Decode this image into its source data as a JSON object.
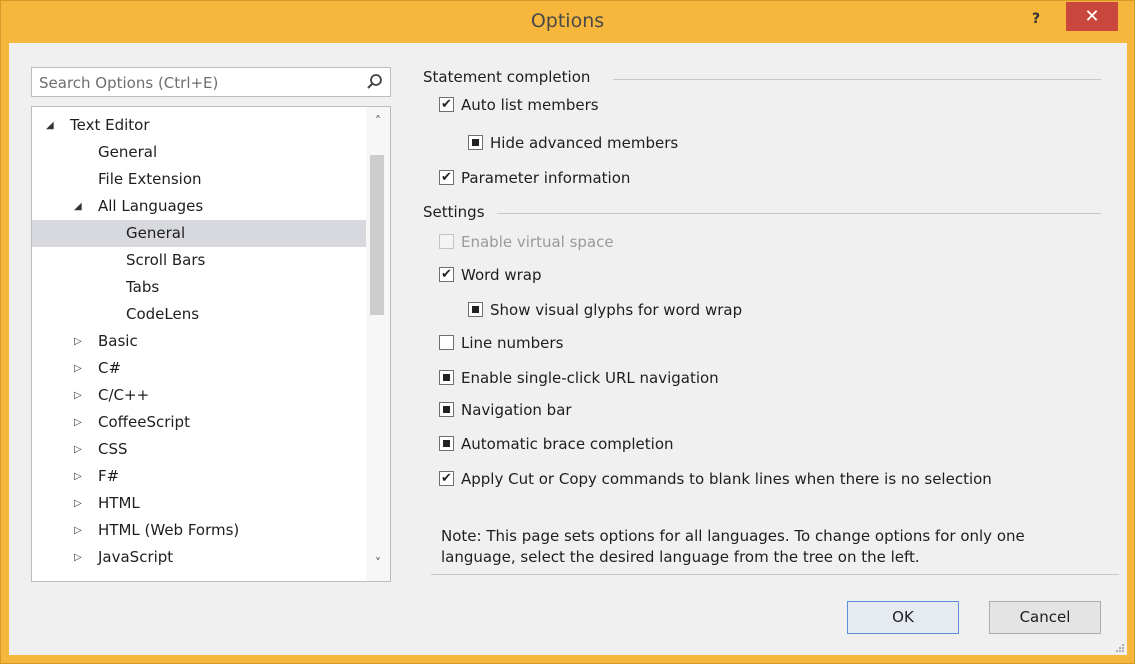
{
  "window": {
    "title": "Options",
    "help_glyph": "?",
    "close_glyph": "✕"
  },
  "search": {
    "placeholder": "Search Options (Ctrl+E)"
  },
  "tree": {
    "items": [
      {
        "label": "Text Editor",
        "arrow": "◢"
      },
      {
        "label": "General",
        "arrow": ""
      },
      {
        "label": "File Extension",
        "arrow": ""
      },
      {
        "label": "All Languages",
        "arrow": "◢"
      },
      {
        "label": "General",
        "arrow": ""
      },
      {
        "label": "Scroll Bars",
        "arrow": ""
      },
      {
        "label": "Tabs",
        "arrow": ""
      },
      {
        "label": "CodeLens",
        "arrow": ""
      },
      {
        "label": "Basic",
        "arrow": "▷"
      },
      {
        "label": "C#",
        "arrow": "▷"
      },
      {
        "label": "C/C++",
        "arrow": "▷"
      },
      {
        "label": "CoffeeScript",
        "arrow": "▷"
      },
      {
        "label": "CSS",
        "arrow": "▷"
      },
      {
        "label": "F#",
        "arrow": "▷"
      },
      {
        "label": "HTML",
        "arrow": "▷"
      },
      {
        "label": "HTML (Web Forms)",
        "arrow": "▷"
      },
      {
        "label": "JavaScript",
        "arrow": "▷"
      }
    ],
    "selected_index": 4,
    "scroll_up": "˄",
    "scroll_down": "˅"
  },
  "statement_completion": {
    "header": "Statement completion",
    "options": [
      {
        "label": "Auto list members",
        "state": "checked"
      },
      {
        "label": "Hide advanced members",
        "state": "indeterminate"
      },
      {
        "label": "Parameter information",
        "state": "checked"
      }
    ]
  },
  "settings": {
    "header": "Settings",
    "options": [
      {
        "label": "Enable virtual space",
        "state": "disabled"
      },
      {
        "label": "Word wrap",
        "state": "checked"
      },
      {
        "label": "Show visual glyphs for word wrap",
        "state": "indeterminate"
      },
      {
        "label": "Line numbers",
        "state": "unchecked"
      },
      {
        "label": "Enable single-click URL navigation",
        "state": "indeterminate"
      },
      {
        "label": "Navigation bar",
        "state": "indeterminate"
      },
      {
        "label": "Automatic brace completion",
        "state": "indeterminate"
      },
      {
        "label": "Apply Cut or Copy commands to blank lines when there is no selection",
        "state": "checked"
      }
    ]
  },
  "note": "Note: This page sets options for all languages. To change options for only one language, select the desired language from the tree on the left.",
  "buttons": {
    "ok": "OK",
    "cancel": "Cancel"
  },
  "colors": {
    "titlebar": "#f6b73c",
    "close": "#c9473c",
    "selection": "#d7d9df"
  }
}
